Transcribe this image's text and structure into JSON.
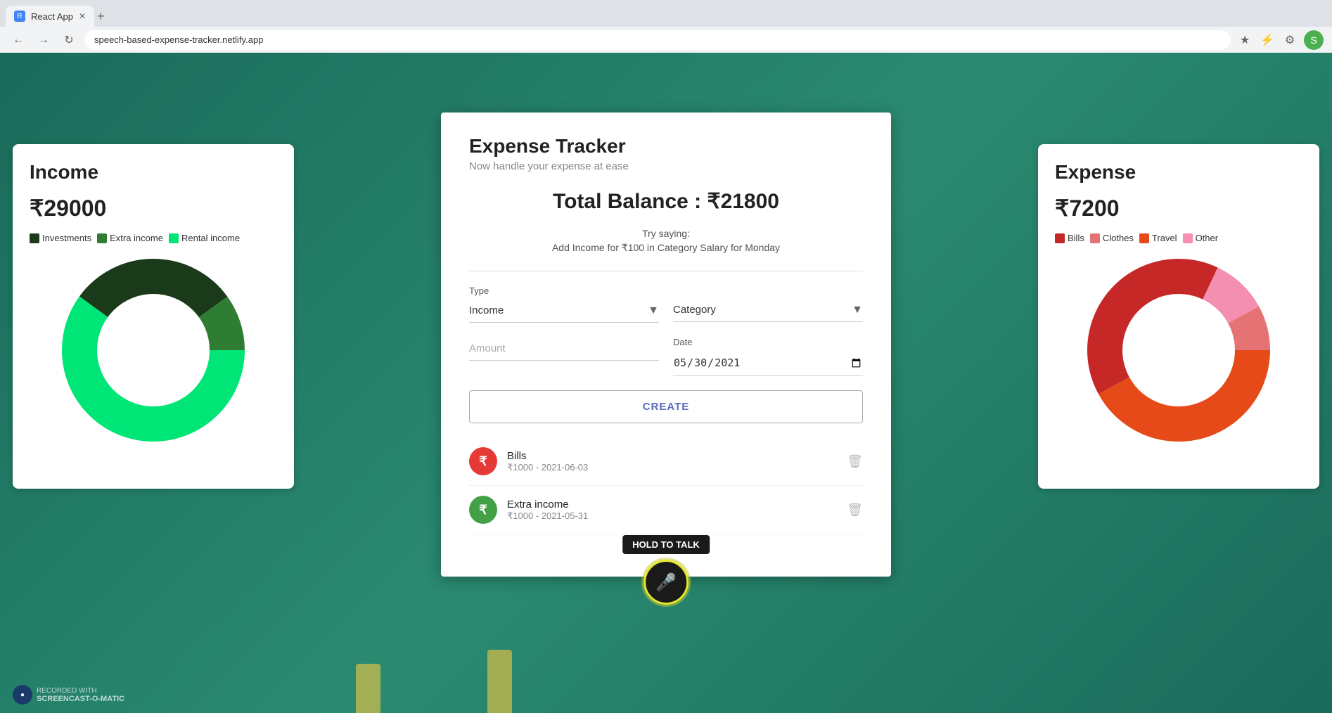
{
  "browser": {
    "tab_label": "React App",
    "url": "speech-based-expense-tracker.netlify.app",
    "new_tab_icon": "+"
  },
  "app": {
    "title": "Expense Tracker",
    "subtitle": "Now handle your expense at ease",
    "total_balance_label": "Total Balance : ₹21800",
    "try_saying": "Try saying:",
    "try_saying_cmd": "Add Income for ₹100 in Category Salary for Monday",
    "form": {
      "type_label": "Type",
      "type_value": "Income",
      "category_label": "",
      "category_placeholder": "Category",
      "amount_placeholder": "Amount",
      "date_label": "Date",
      "date_value": "30-05-2021",
      "create_button": "CREATE",
      "hold_to_talk": "HOLD TO TALK"
    },
    "transactions": [
      {
        "name": "Bills",
        "meta": "₹1000 - 2021-06-03",
        "type": "expense",
        "icon": "₹"
      },
      {
        "name": "Extra income",
        "meta": "₹1000 - 2021-05-31",
        "type": "income",
        "icon": "₹"
      }
    ]
  },
  "income_panel": {
    "title": "Income",
    "amount": "₹29000",
    "legend": [
      {
        "label": "Investments",
        "color": "#1a3a1a"
      },
      {
        "label": "Extra income",
        "color": "#2e7d32"
      },
      {
        "label": "Rental income",
        "color": "#00e676"
      }
    ],
    "donut": {
      "segments": [
        {
          "label": "Investments",
          "color": "#1a3a1a",
          "pct": 30
        },
        {
          "label": "Extra income",
          "color": "#2e7d32",
          "pct": 10
        },
        {
          "label": "Rental income",
          "color": "#00e676",
          "pct": 60
        }
      ]
    }
  },
  "expense_panel": {
    "title": "Expense",
    "amount": "₹7200",
    "legend": [
      {
        "label": "Bills",
        "color": "#c62828"
      },
      {
        "label": "Clothes",
        "color": "#e57373"
      },
      {
        "label": "Travel",
        "color": "#e64a19"
      },
      {
        "label": "Other",
        "color": "#f48fb1"
      }
    ],
    "donut": {
      "segments": [
        {
          "label": "Bills",
          "color": "#c62828",
          "pct": 40
        },
        {
          "label": "Clothes",
          "color": "#e57373",
          "pct": 8
        },
        {
          "label": "Travel",
          "color": "#e64a19",
          "pct": 42
        },
        {
          "label": "Other",
          "color": "#f48fb1",
          "pct": 10
        }
      ]
    }
  },
  "watermark": {
    "line1": "RECORDED WITH",
    "line2": "SCREENCAST-O-MATIC"
  }
}
